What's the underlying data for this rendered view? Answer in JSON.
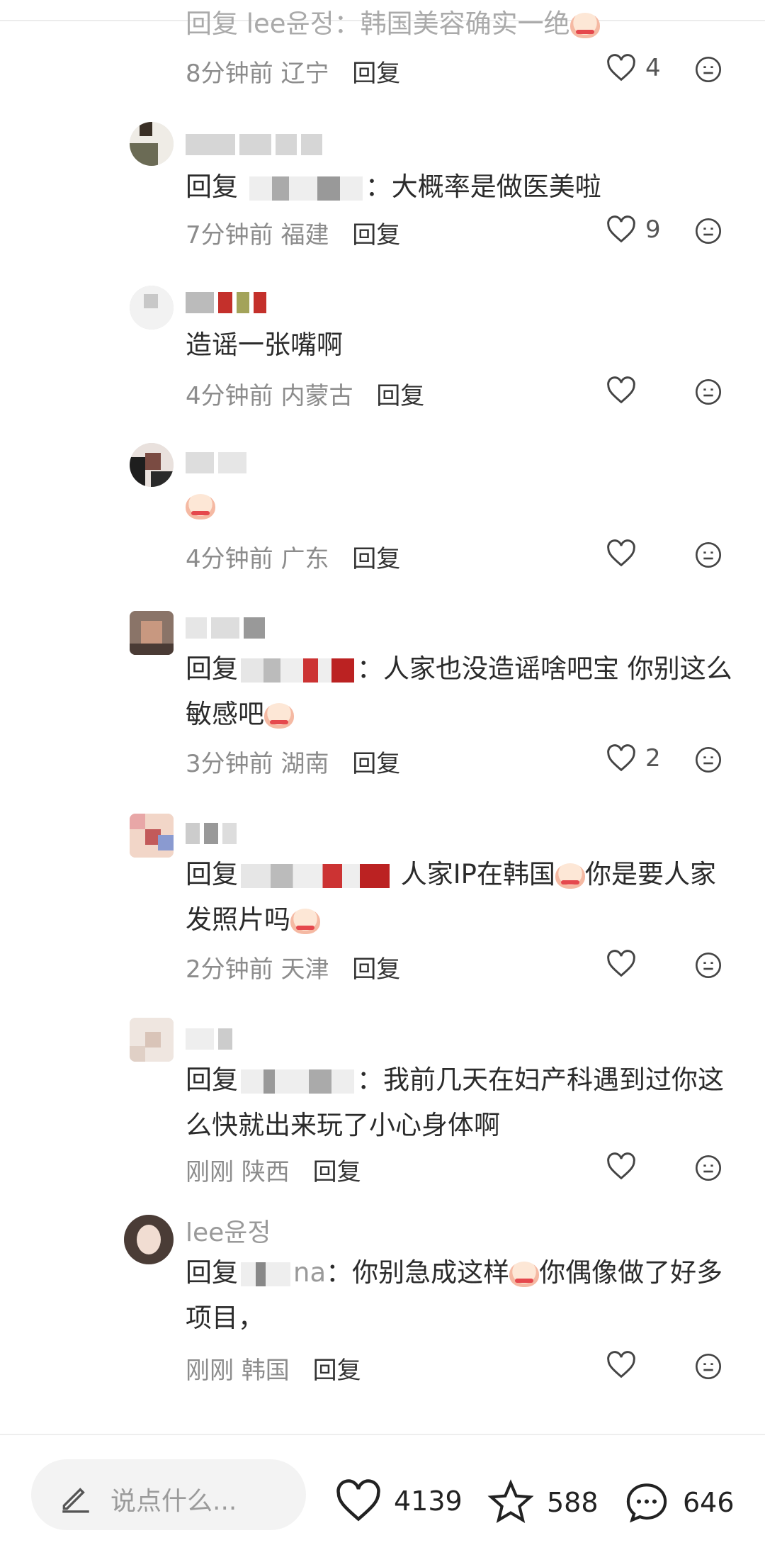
{
  "comments": [
    {
      "type": "reply",
      "reply_label": "回复",
      "reply_to": "lee윤정",
      "text": "韩国美容确实一绝",
      "emoji": "crying-laugh-emoji",
      "time": "8分钟前",
      "location": "辽宁",
      "action": "回复",
      "likes": "4"
    },
    {
      "type": "reply",
      "reply_label": "回复",
      "text": "大概率是做医美啦",
      "time": "7分钟前",
      "location": "福建",
      "action": "回复",
      "likes": "9"
    },
    {
      "type": "top",
      "text": "造谣一张嘴啊",
      "time": "4分钟前",
      "location": "内蒙古",
      "action": "回复",
      "likes": ""
    },
    {
      "type": "top",
      "text": "",
      "emoji": "crying-laugh-emoji",
      "time": "4分钟前",
      "location": "广东",
      "action": "回复",
      "likes": ""
    },
    {
      "type": "reply",
      "reply_label": "回复",
      "text": "人家也没造谣啥吧宝 你别这么敏感吧",
      "emoji": "crying-laugh-emoji",
      "time": "3分钟前",
      "location": "湖南",
      "action": "回复",
      "likes": "2"
    },
    {
      "type": "reply",
      "reply_label": "回复",
      "text_a": "人家IP在韩国",
      "text_b": "你是要人家发照片吗",
      "emoji": "crying-laugh-emoji",
      "time": "2分钟前",
      "location": "天津",
      "action": "回复",
      "likes": ""
    },
    {
      "type": "reply",
      "reply_label": "回复",
      "text": "我前几天在妇产科遇到过你这么快就出来玩了小心身体啊",
      "time": "刚刚",
      "location": "陕西",
      "action": "回复",
      "likes": ""
    },
    {
      "type": "reply",
      "author": "lee윤정",
      "reply_label": "回复",
      "reply_to_suffix": "na",
      "text_a": "你别急成这样",
      "text_b": "你偶像做了好多项目，",
      "emoji": "crying-laugh-emoji",
      "time": "刚刚",
      "location": "韩国",
      "action": "回复",
      "likes": ""
    }
  ],
  "bottom_bar": {
    "placeholder": "说点什么...",
    "likes": "4139",
    "favorites": "588",
    "comments": "646"
  },
  "colors": {
    "muted": "#8c8c8c",
    "text": "#2b2b2b",
    "accent": "#e5484d"
  }
}
